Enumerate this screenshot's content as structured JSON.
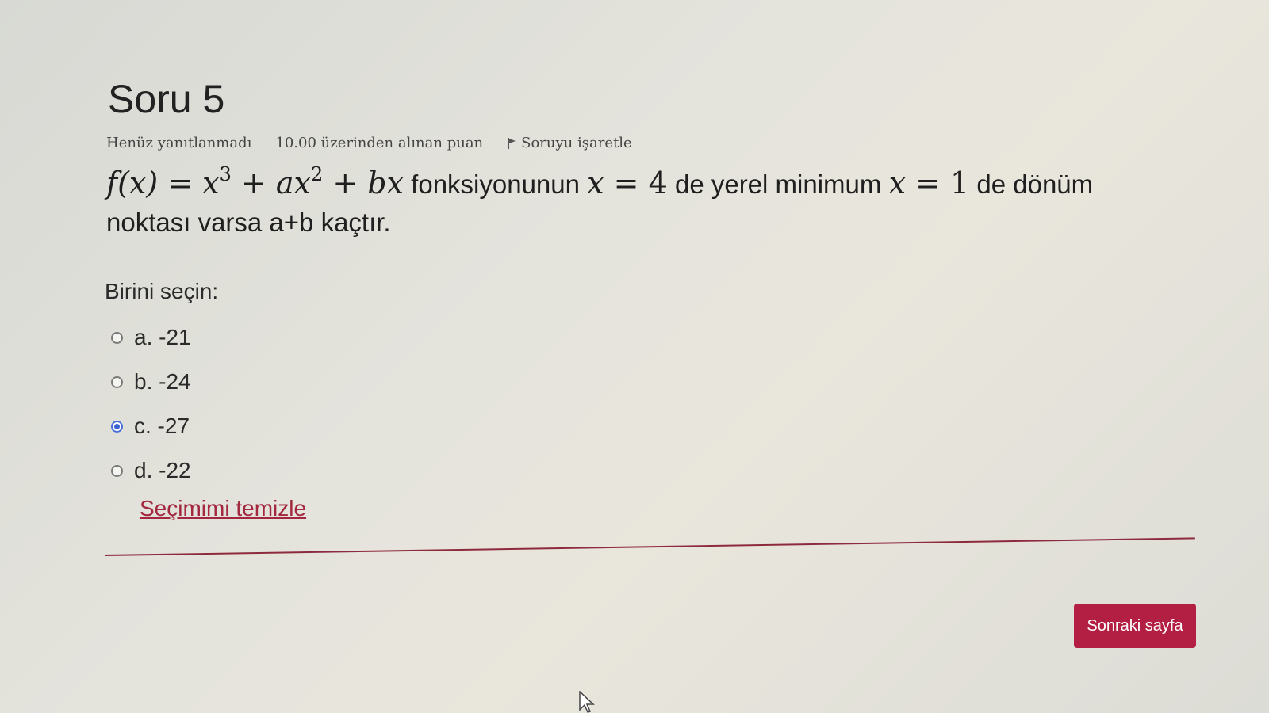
{
  "question": {
    "title": "Soru 5",
    "status": "Henüz yanıtlanmadı",
    "points": "10.00 üzerinden alınan puan",
    "flag_label": "Soruyu işaretle",
    "text_mid": "fonksiyonunun",
    "text_de1": "de yerel minimum",
    "text_de2": "de dönüm",
    "text_end": "noktası varsa a+b kaçtır."
  },
  "answers": {
    "prompt": "Birini seçin:",
    "options": [
      {
        "label": "a. -21",
        "selected": false
      },
      {
        "label": "b. -24",
        "selected": false
      },
      {
        "label": "c. -27",
        "selected": true
      },
      {
        "label": "d. -22",
        "selected": false
      }
    ],
    "clear_label": "Seçimimi temizle"
  },
  "nav": {
    "next_label": "Sonraki sayfa"
  },
  "colors": {
    "accent": "#b31f43",
    "link": "#a3283f",
    "radio_checked": "#3c63d2"
  },
  "icons": {
    "flag": "flag-icon",
    "cursor": "mouse-pointer-icon"
  }
}
